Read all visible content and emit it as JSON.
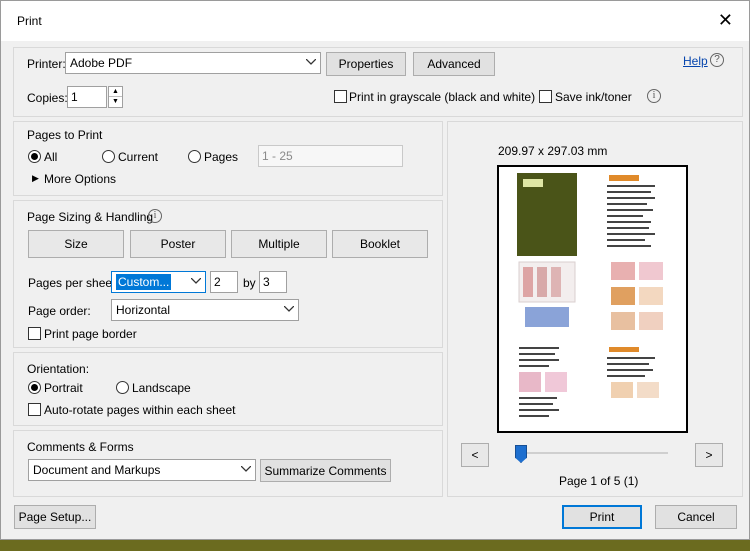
{
  "window": {
    "title": "Print"
  },
  "printer": {
    "label": "Printer:",
    "selected": "Adobe PDF",
    "properties_label": "Properties",
    "advanced_label": "Advanced",
    "help_label": "Help"
  },
  "copies": {
    "label": "Copies:",
    "value": "1",
    "grayscale_label": "Print in grayscale (black and white)",
    "grayscale_checked": false,
    "save_ink_label": "Save ink/toner",
    "save_ink_checked": false
  },
  "pages_to_print": {
    "title": "Pages to Print",
    "all_label": "All",
    "current_label": "Current",
    "pages_label": "Pages",
    "selected": "All",
    "pages_range_value": "1 - 25",
    "more_options_label": "More Options"
  },
  "sizing": {
    "title": "Page Sizing & Handling",
    "buttons": [
      "Size",
      "Poster",
      "Multiple",
      "Booklet"
    ],
    "pages_per_sheet_label": "Pages per sheet:",
    "pages_per_sheet_value": "Custom...",
    "cols_value": "2",
    "by_label": "by",
    "rows_value": "3",
    "page_order_label": "Page order:",
    "page_order_value": "Horizontal",
    "print_border_label": "Print page border",
    "print_border_checked": false
  },
  "orientation": {
    "title": "Orientation:",
    "portrait_label": "Portrait",
    "landscape_label": "Landscape",
    "selected": "Portrait",
    "auto_rotate_label": "Auto-rotate pages within each sheet",
    "auto_rotate_checked": false
  },
  "comments_forms": {
    "title": "Comments & Forms",
    "selected": "Document and Markups",
    "summarize_label": "Summarize Comments"
  },
  "preview": {
    "dimensions": "209.97 x 297.03 mm",
    "prev_label": "<",
    "next_label": ">",
    "page_status": "Page 1 of 5 (1)",
    "slider_position": 0.0
  },
  "footer": {
    "page_setup_label": "Page Setup...",
    "print_label": "Print",
    "cancel_label": "Cancel"
  },
  "colors": {
    "accent": "#0078d7",
    "preview_cover": "#4a5418",
    "background_app": "#6b6b1f"
  }
}
